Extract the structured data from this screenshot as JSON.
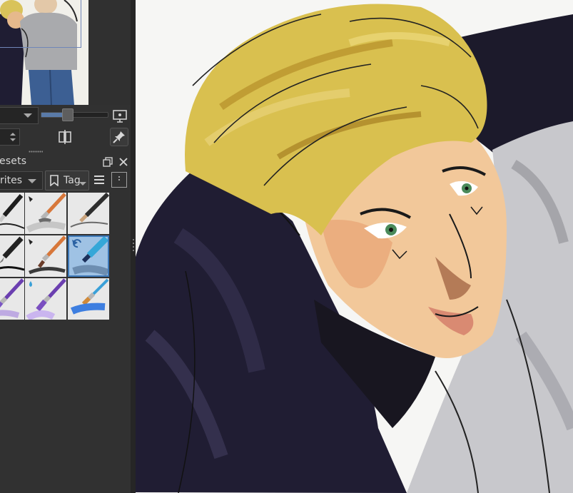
{
  "app": {
    "accent": "#3d78b8",
    "panel_bg": "#313131",
    "canvas_bg": "#f7f7f5"
  },
  "overview": {
    "thumbnail": "overview-thumbnail"
  },
  "navigation": {
    "zoom_level": 0.4,
    "present_icon": "presentation-icon",
    "mirror_icon": "mirror-icon",
    "pin_icon": "pin-icon"
  },
  "brush_presets": {
    "title": "esets",
    "tag_filter": "rites",
    "tag_button": "Tag",
    "presets": [
      {
        "icon": "ink-pen-preset-icon"
      },
      {
        "icon": "airbrush-soft-preset-icon"
      },
      {
        "icon": "pencil-preset-icon"
      },
      {
        "icon": "fountain-pen-preset-icon"
      },
      {
        "icon": "basic-brush-preset-icon"
      },
      {
        "icon": "marker-preset-icon",
        "selected": true
      },
      {
        "icon": "watercolor-brush-preset-icon"
      },
      {
        "icon": "bristle-brush-preset-icon"
      },
      {
        "icon": "blender-brush-preset-icon"
      }
    ]
  },
  "canvas": {
    "subject": "painting-canvas"
  }
}
